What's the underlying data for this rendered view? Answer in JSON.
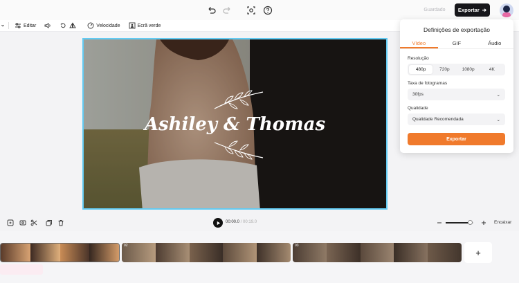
{
  "topbar": {
    "saved_label": "Guardado",
    "export_label": "Exportar"
  },
  "toolbar": {
    "edit_label": "Editar",
    "speed_label": "Velocidade",
    "greenscreen_label": "Ecrã verde"
  },
  "video": {
    "title_text": "Ashiley & Thomas"
  },
  "export_panel": {
    "title": "Definições de exportação",
    "tabs": [
      "Vídeo",
      "GIF",
      "Áudio"
    ],
    "resolution_label": "Resolução",
    "resolutions": [
      "480p",
      "720p",
      "1080p",
      "4K"
    ],
    "selected_resolution": "480p",
    "framerate_label": "Taxa de fotogramas",
    "framerate_value": "30fps",
    "quality_label": "Qualidade",
    "quality_value": "Qualidade Recomendada",
    "export_button": "Exportar"
  },
  "playback": {
    "current_time": "00:00.0",
    "total_time": "/ 00:19.0",
    "zoom_level": 0.88,
    "fit_label": "Encaixar"
  },
  "timeline": {
    "clip_numbers": [
      "",
      "02",
      "03"
    ],
    "add_label": "+"
  },
  "colors": {
    "accent": "#f07a2c",
    "selection": "#62cbf3",
    "dark": "#16161a"
  }
}
